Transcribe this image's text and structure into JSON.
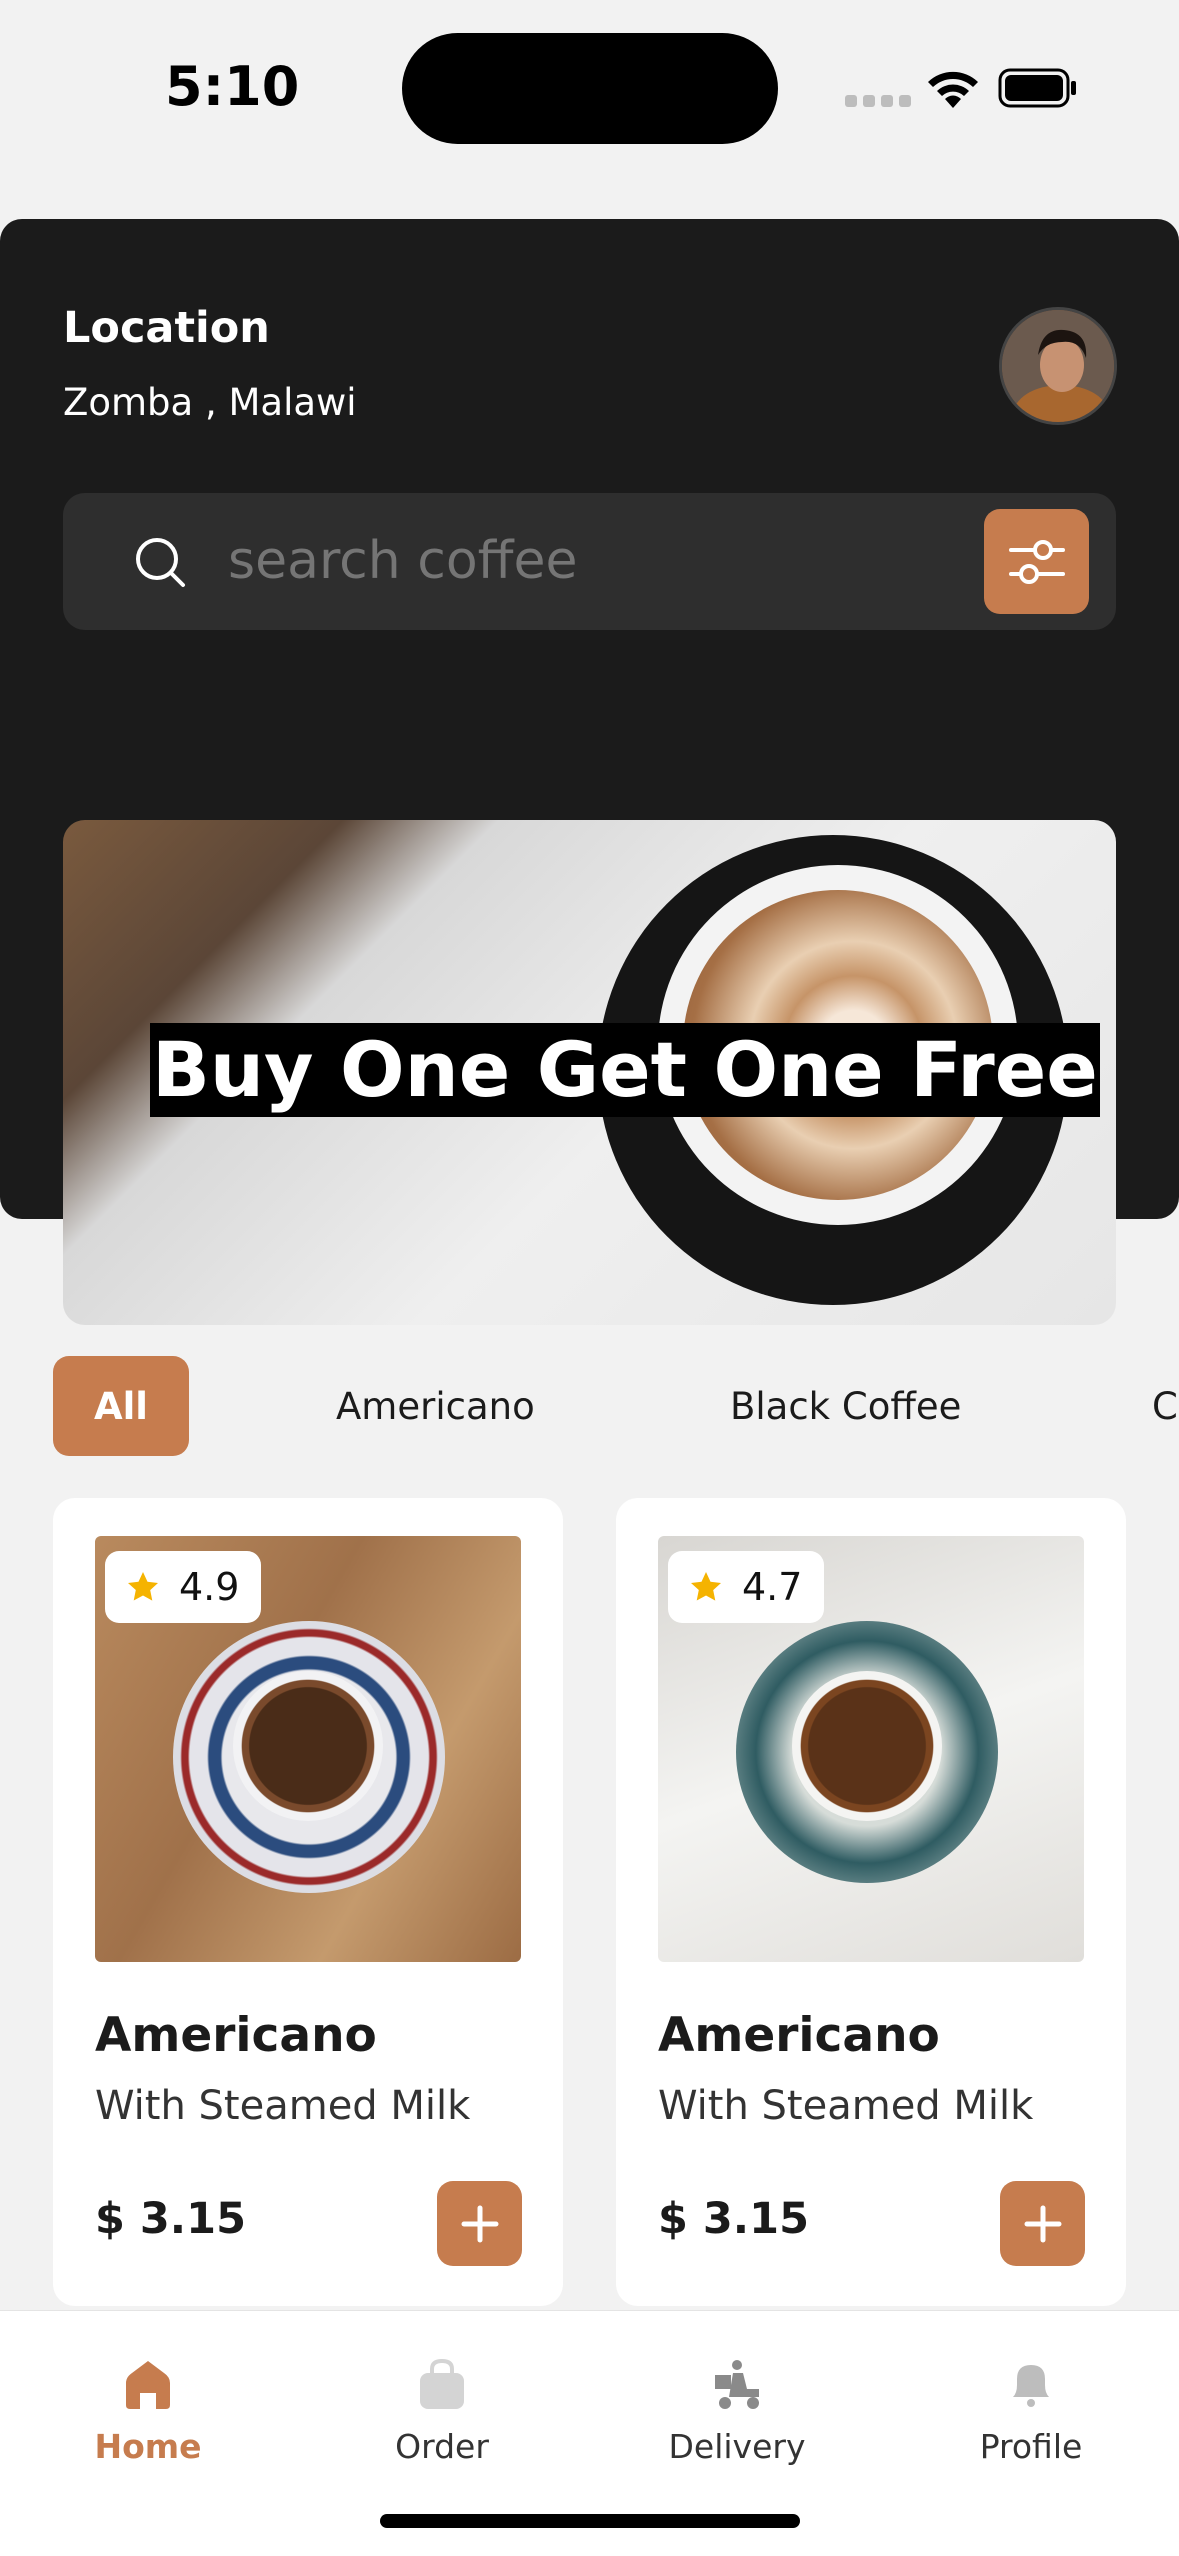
{
  "status_bar": {
    "time": "5:10"
  },
  "header": {
    "location_label": "Location",
    "location_value": "Zomba , Malawi"
  },
  "search": {
    "placeholder": "search coffee"
  },
  "promo": {
    "text": "Buy One Get One Free"
  },
  "categories": [
    {
      "label": "All",
      "active": true
    },
    {
      "label": "Americano",
      "active": false
    },
    {
      "label": "Black Coffee",
      "active": false
    },
    {
      "label": "C",
      "active": false
    }
  ],
  "products": [
    {
      "rating": "4.9",
      "name": "Americano",
      "subtitle": "With Steamed Milk",
      "price": "$ 3.15"
    },
    {
      "rating": "4.7",
      "name": "Americano",
      "subtitle": "With Steamed Milk",
      "price": "$ 3.15"
    }
  ],
  "tab_bar": {
    "tabs": [
      {
        "label": "Home",
        "icon": "home-icon",
        "active": true
      },
      {
        "label": "Order",
        "icon": "bag-icon",
        "active": false
      },
      {
        "label": "Delivery",
        "icon": "delivery-scooter-icon",
        "active": false
      },
      {
        "label": "Profile",
        "icon": "bell-icon",
        "active": false
      }
    ]
  },
  "colors": {
    "accent": "#c67c4e",
    "header_bg": "#1b1b1b",
    "page_bg": "#f2f2f2"
  }
}
